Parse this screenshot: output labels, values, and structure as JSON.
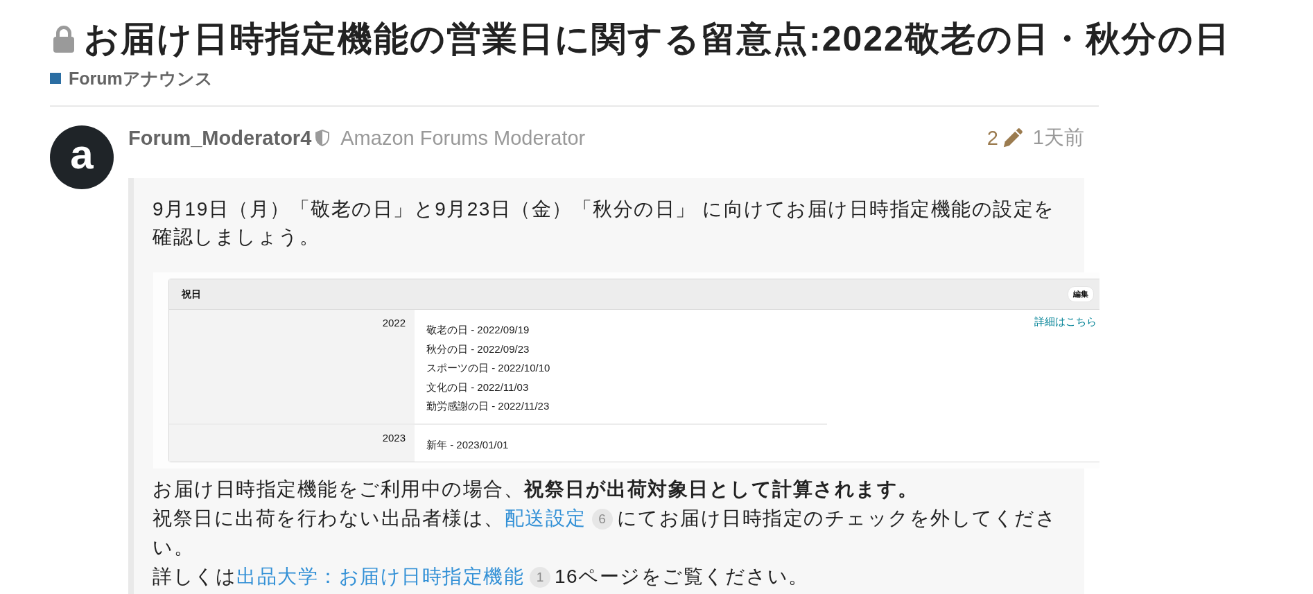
{
  "topic": {
    "locked": true,
    "title": "お届け日時指定機能の営業日に関する留意点:2022敬老の日・秋分の日",
    "category": "Forumアナウンス"
  },
  "post": {
    "avatar_letter": "a",
    "username": "Forum_Moderator4",
    "moderator": true,
    "user_title": "Amazon Forums Moderator",
    "edit_count": "2",
    "age": "1天前",
    "body": [
      {
        "kind": "paragraph",
        "lines": [
          [
            {
              "kind": "text",
              "text": "9月19日（月）「敬老の日」と9月23日（金）「秋分の日」 に向けてお届け日時指定機能の設定を確認しましょう。"
            }
          ]
        ]
      },
      {
        "kind": "screenshot",
        "panel": {
          "title": "祝日",
          "button": "編集",
          "link": "詳細はこちら",
          "groups": [
            {
              "year": "2022",
              "holidays": [
                "敬老の日 - 2022/09/19",
                "秋分の日 - 2022/09/23",
                "スポーツの日 - 2022/10/10",
                "文化の日 - 2022/11/03",
                "勤労感謝の日 - 2022/11/23"
              ]
            },
            {
              "year": "2023",
              "holidays": [
                "新年 - 2023/01/01"
              ]
            }
          ]
        }
      },
      {
        "kind": "paragraph",
        "lines": [
          [
            {
              "kind": "text",
              "text": "お届け日時指定機能をご利用中の場合、**祝祭日が出荷対象日として計算されます。**"
            }
          ],
          [
            {
              "kind": "text",
              "text": "祝祭日に出荷を行わない出品者様は、"
            },
            {
              "kind": "link",
              "text": "配送設定",
              "clicks": "6"
            },
            {
              "kind": "text",
              "text": "にてお届け日時指定のチェックを外してください。"
            }
          ],
          [
            {
              "kind": "text",
              "text": "詳しくは"
            },
            {
              "kind": "link",
              "text": "出品大学：お届け日時指定機能",
              "clicks": "1"
            },
            {
              "kind": "text",
              "text": "16ページをご覧ください。"
            }
          ]
        ]
      }
    ]
  }
}
